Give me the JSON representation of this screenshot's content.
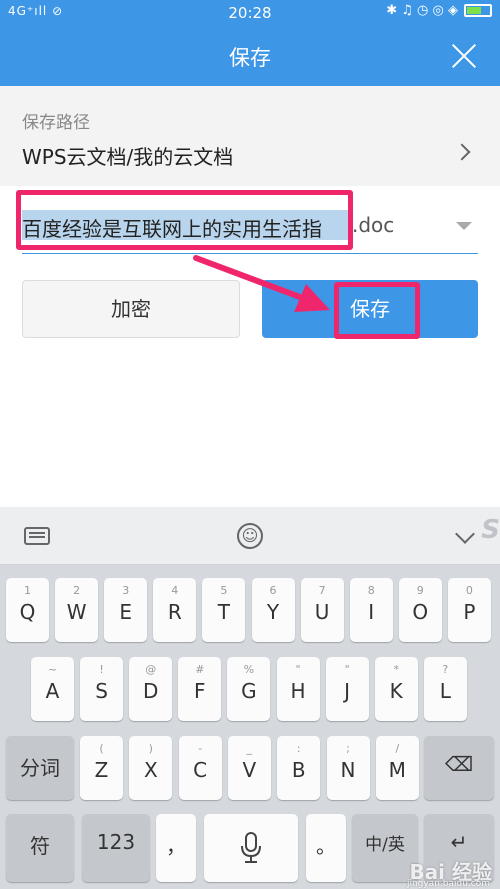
{
  "statusbar": {
    "signal": "4G⁺ıll ⊘",
    "time": "20:28",
    "icons": "✱ ♫ ◷ ◎ ◈"
  },
  "dialog": {
    "title": "保存",
    "path_label": "保存路径",
    "path_value": "WPS云文档/我的云文档",
    "filename": "百度经验是互联网上的实用生活指",
    "extension": ".doc",
    "encrypt_label": "加密",
    "save_label": "保存"
  },
  "keyboard": {
    "row1": [
      {
        "sub": "1",
        "main": "Q"
      },
      {
        "sub": "2",
        "main": "W"
      },
      {
        "sub": "3",
        "main": "E"
      },
      {
        "sub": "4",
        "main": "R"
      },
      {
        "sub": "5",
        "main": "T"
      },
      {
        "sub": "6",
        "main": "Y"
      },
      {
        "sub": "7",
        "main": "U"
      },
      {
        "sub": "8",
        "main": "I"
      },
      {
        "sub": "9",
        "main": "O"
      },
      {
        "sub": "0",
        "main": "P"
      }
    ],
    "row2": [
      {
        "sub": "~",
        "main": "A"
      },
      {
        "sub": "!",
        "main": "S"
      },
      {
        "sub": "@",
        "main": "D"
      },
      {
        "sub": "#",
        "main": "F"
      },
      {
        "sub": "%",
        "main": "G"
      },
      {
        "sub": "\"",
        "main": "H"
      },
      {
        "sub": "\"",
        "main": "J"
      },
      {
        "sub": "*",
        "main": "K"
      },
      {
        "sub": "?",
        "main": "L"
      }
    ],
    "row3": [
      {
        "sub": "(",
        "main": "Z"
      },
      {
        "sub": ")",
        "main": "X"
      },
      {
        "sub": "-",
        "main": "C"
      },
      {
        "sub": "_",
        "main": "V"
      },
      {
        "sub": ":",
        "main": "B"
      },
      {
        "sub": ";",
        "main": "N"
      },
      {
        "sub": "/",
        "main": "M"
      }
    ],
    "segment_label": "分词",
    "symbol_label": "符",
    "numeric_label": "123",
    "comma_label": "，",
    "period_label": "。",
    "lang_label": "中/英",
    "backspace_glyph": "⌫",
    "enter_glyph": "↵"
  },
  "watermark": {
    "brand": "Bai 经验",
    "url": "jingyan.baidu.com"
  }
}
